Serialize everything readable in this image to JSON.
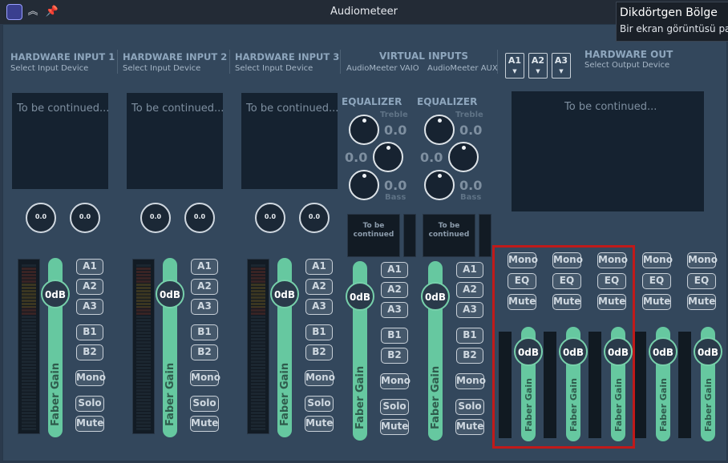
{
  "window": {
    "title": "Audiometeer"
  },
  "tooltip": {
    "title": "Dikdörtgen Bölge",
    "text": "Bir ekran görüntüsü pa"
  },
  "hw_inputs": [
    {
      "title": "HARDWARE INPUT  1",
      "sub": "Select Input Device",
      "screen": "To be continued...",
      "knob1": "0.0",
      "knob2": "0.0",
      "gain": "0dB",
      "fader_label": "Faber Gain",
      "a1": "A1",
      "a2": "A2",
      "a3": "A3",
      "b1": "B1",
      "b2": "B2",
      "mono": "Mono",
      "solo": "Solo",
      "mute": "Mute"
    },
    {
      "title": "HARDWARE INPUT  2",
      "sub": "Select Input Device",
      "screen": "To be continued...",
      "knob1": "0.0",
      "knob2": "0.0",
      "gain": "0dB",
      "fader_label": "Faber Gain",
      "a1": "A1",
      "a2": "A2",
      "a3": "A3",
      "b1": "B1",
      "b2": "B2",
      "mono": "Mono",
      "solo": "Solo",
      "mute": "Mute"
    },
    {
      "title": "HARDWARE INPUT  3",
      "sub": "Select Input Device",
      "screen": "To be continued...",
      "knob1": "0.0",
      "knob2": "0.0",
      "gain": "0dB",
      "fader_label": "Faber Gain",
      "a1": "A1",
      "a2": "A2",
      "a3": "A3",
      "b1": "B1",
      "b2": "B2",
      "mono": "Mono",
      "solo": "Solo",
      "mute": "Mute"
    }
  ],
  "virtual": {
    "title": "VIRTUAL INPUTS",
    "sub1": "AudioMeeter VAIO",
    "sub2": "AudioMeeter AUX",
    "strips": [
      {
        "eq": "EQUALIZER",
        "treble_lbl": "Treble",
        "bass_lbl": "Bass",
        "treble": "0.0",
        "mid": "0.0",
        "bass": "0.0",
        "mini": "To be continued",
        "gain": "0dB",
        "fader_label": "Faber Gain",
        "a1": "A1",
        "a2": "A2",
        "a3": "A3",
        "b1": "B1",
        "b2": "B2",
        "mono": "Mono",
        "solo": "Solo",
        "mute": "Mute"
      },
      {
        "eq": "EQUALIZER",
        "treble_lbl": "Treble",
        "bass_lbl": "Bass",
        "treble": "0.0",
        "mid": "0.0",
        "bass": "0.0",
        "mini": "To be continued",
        "gain": "0dB",
        "fader_label": "Faber Gain",
        "a1": "A1",
        "a2": "A2",
        "a3": "A3",
        "b1": "B1",
        "b2": "B2",
        "mono": "Mono",
        "solo": "Solo",
        "mute": "Mute"
      }
    ]
  },
  "out_select": [
    "A1",
    "A2",
    "A3"
  ],
  "hw_out": {
    "title": "HARDWARE OUT",
    "sub": "Select Output Device",
    "screen": "To be continued..."
  },
  "outputs": [
    {
      "mono": "Mono",
      "eq": "EQ",
      "mute": "Mute",
      "gain": "0dB",
      "fader_label": "Faber Gain"
    },
    {
      "mono": "Mono",
      "eq": "EQ",
      "mute": "Mute",
      "gain": "0dB",
      "fader_label": "Faber Gain"
    },
    {
      "mono": "Mono",
      "eq": "EQ",
      "mute": "Mute",
      "gain": "0dB",
      "fader_label": "Faber Gain"
    },
    {
      "mono": "Mono",
      "eq": "EQ",
      "mute": "Mute",
      "gain": "0dB",
      "fader_label": "Faber Gain"
    },
    {
      "mono": "Mono",
      "eq": "EQ",
      "mute": "Mute",
      "gain": "0dB",
      "fader_label": "Faber Gain"
    }
  ]
}
